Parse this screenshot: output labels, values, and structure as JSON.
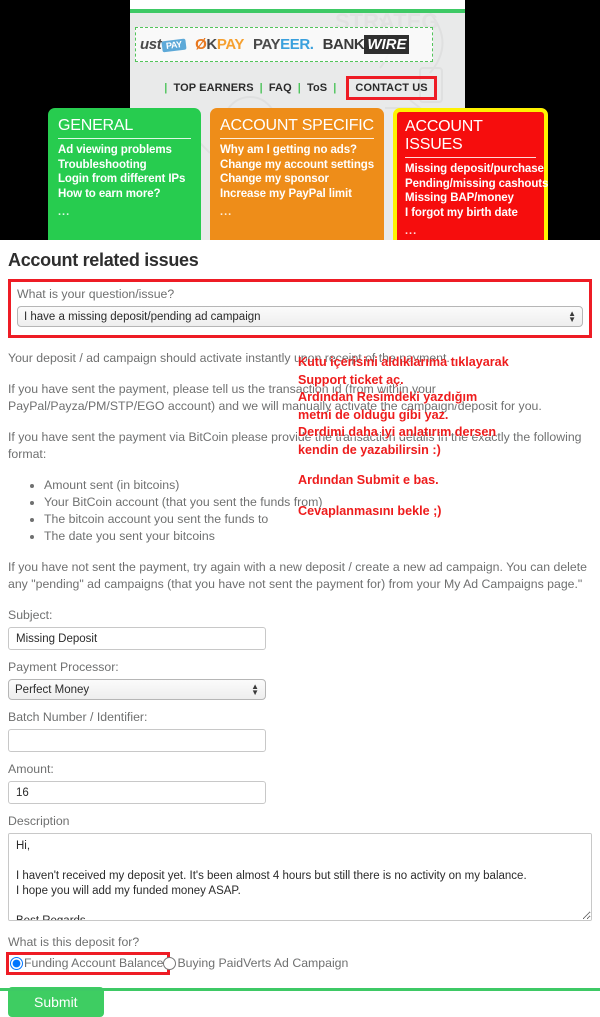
{
  "top_screenshot": {
    "payment_logos": [
      {
        "name": "trustpay-logo",
        "text": "ust",
        "badge": "PAY"
      },
      {
        "name": "okpay-logo",
        "o": "Ø",
        "k": "K",
        "pay": "PAY"
      },
      {
        "name": "payeer-logo",
        "pay": "PAY",
        "eer": "EER."
      },
      {
        "name": "bankwire-logo",
        "bank": "BANK",
        "wire": "WIRE"
      }
    ],
    "nav": {
      "separator": "|",
      "items": [
        {
          "label": "TOP EARNERS",
          "highlighted": false
        },
        {
          "label": "FAQ",
          "highlighted": false
        },
        {
          "label": "ToS",
          "highlighted": false
        },
        {
          "label": "CONTACT US",
          "highlighted": true
        }
      ]
    },
    "panels": [
      {
        "id": "general",
        "title": "GENERAL",
        "color": "#27cc4f",
        "items": [
          "Ad viewing problems",
          "Troubleshooting",
          "Login from different IPs",
          "How to earn more?"
        ],
        "more": "..."
      },
      {
        "id": "account-specific",
        "title": "ACCOUNT SPECIFIC",
        "color": "#ee8d19",
        "items": [
          "Why am I getting no ads?",
          "Change my account settings",
          "Change my sponsor",
          "Increase my PayPal limit"
        ],
        "more": "..."
      },
      {
        "id": "account-issues",
        "title": "ACCOUNT ISSUES",
        "color": "#f60d0d",
        "highlight_color": "#fff200",
        "items": [
          "Missing deposit/purchase",
          "Pending/missing cashouts",
          "Missing BAP/money",
          "I forgot my birth date"
        ],
        "more": "..."
      }
    ]
  },
  "page": {
    "title": "Account related issues",
    "question_label": "What is your question/issue?",
    "question_value": "I have a missing deposit/pending ad campaign",
    "question_options": [
      "I have a missing deposit/pending ad campaign"
    ],
    "paragraphs": [
      "Your deposit / ad campaign should activate instantly upon receipt of the payment.",
      "If you have sent the payment, please tell us the transaction id (from within your PayPal/Payza/PM/STP/EGO account) and we will manually activate the campaign/deposit for you.",
      "If you have sent the payment via BitCoin please provide the transaction details in the exactly the following format:"
    ],
    "bitcoin_details": [
      "Amount sent (in bitcoins)",
      "Your BitCoin account (that you sent the funds from)",
      "The bitcoin account you sent the funds to",
      "The date you sent your bitcoins"
    ],
    "closing_paragraph": "If you have not sent the payment, try again with a new deposit / create a new ad campaign. You can delete any \"pending\" ad campaigns (that you have not sent the payment for) from your My Ad Campaigns page.\""
  },
  "form": {
    "subject_label": "Subject:",
    "subject_value": "Missing Deposit",
    "processor_label": "Payment Processor:",
    "processor_value": "Perfect Money",
    "processor_options": [
      "Perfect Money"
    ],
    "batch_label": "Batch Number / Identifier:",
    "batch_value": "",
    "batch_placeholder": "",
    "amount_label": "Amount:",
    "amount_value": "16",
    "description_label": "Description",
    "description_value": "Hi,\n\nI haven't received my deposit yet. It's been almost 4 hours but still there is no activity on my balance.\nI hope you will add my funded money ASAP.\n\nBest Regards.",
    "deposit_for_label": "What is this deposit for?",
    "radio_options": [
      {
        "label": "Funding Account Balance",
        "selected": true,
        "highlighted": true
      },
      {
        "label": "Buying PaidVerts Ad Campaign",
        "selected": false,
        "highlighted": false
      }
    ],
    "submit_label": "Submit"
  },
  "annotation": {
    "color": "#ee1c1c",
    "lines": [
      "Kutu içerisini aldıklarıma tıklayarak",
      "Support ticket aç.",
      "Ardından Resimdeki yazdığım",
      "metni de olduğu gibi yaz.",
      "Derdimi daha iyi anlatırım dersen",
      "kendin de yazabilirsin :)"
    ],
    "line_submit": "Ardından Submit e bas.",
    "line_wait": "Cevaplanmasını bekle ;)"
  },
  "colors": {
    "green_accent": "#3ec965",
    "red_highlight": "#ee1c25",
    "yellow_highlight": "#fff200",
    "orange_panel": "#ee8d19",
    "submit_green": "#3ecd62"
  }
}
